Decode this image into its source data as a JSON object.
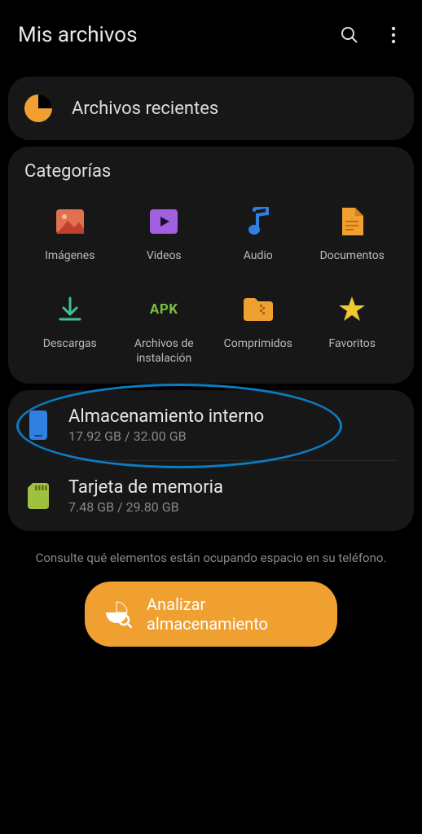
{
  "header": {
    "title": "Mis archivos"
  },
  "recent": {
    "label": "Archivos recientes"
  },
  "categories": {
    "title": "Categorías",
    "items": [
      {
        "label": "Imágenes"
      },
      {
        "label": "Videos"
      },
      {
        "label": "Audio"
      },
      {
        "label": "Documentos"
      },
      {
        "label": "Descargas"
      },
      {
        "label": "Archivos de instalación"
      },
      {
        "label": "Comprimidos"
      },
      {
        "label": "Favoritos"
      }
    ]
  },
  "storage": {
    "internal": {
      "title": "Almacenamiento interno",
      "sub": "17.92 GB / 32.00 GB"
    },
    "sdcard": {
      "title": "Tarjeta de memoria",
      "sub": "7.48 GB / 29.80 GB"
    }
  },
  "hint": "Consulte qué elementos están ocupando espacio en su teléfono.",
  "analyze": {
    "label": "Analizar almacenamiento"
  }
}
